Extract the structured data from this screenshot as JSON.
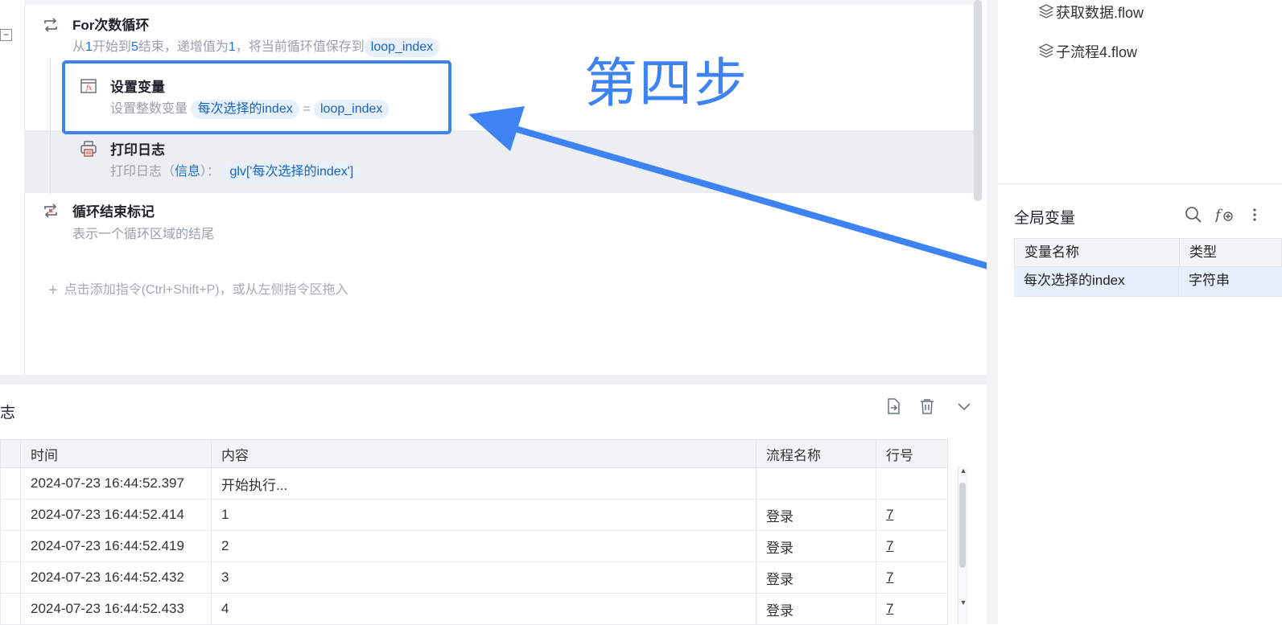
{
  "editor": {
    "collapse_symbol": "−",
    "loop_step": {
      "title": "For次数循环",
      "desc_1": "从",
      "start": "1",
      "desc_2": "开始到",
      "end": "5",
      "desc_3": "结束，递增值为",
      "step": "1",
      "desc_4": "，将当前循环值保存到",
      "var": "loop_index"
    },
    "set_var_step": {
      "title": "设置变量",
      "desc": "设置整数变量",
      "target": "每次选择的index",
      "equals": "=",
      "value": "loop_index"
    },
    "print_step": {
      "title": "打印日志",
      "desc_1": "打印日志（",
      "level": "信息",
      "desc_2": "）：",
      "expr": "glv['每次选择的index']"
    },
    "loop_end_step": {
      "title": "循环结束标记",
      "desc": "表示一个循环区域的结尾"
    },
    "add_hint": "点击添加指令(Ctrl+Shift+P)，或从左侧指令区拖入",
    "annotation": "第四步"
  },
  "log": {
    "title": "志",
    "columns": [
      "时间",
      "内容",
      "流程名称",
      "行号"
    ],
    "rows": [
      {
        "time": "2024-07-23 16:44:52.397",
        "content": "开始执行...",
        "flow": "",
        "line": ""
      },
      {
        "time": "2024-07-23 16:44:52.414",
        "content": "1",
        "flow": "登录",
        "line": "7"
      },
      {
        "time": "2024-07-23 16:44:52.419",
        "content": "2",
        "flow": "登录",
        "line": "7"
      },
      {
        "time": "2024-07-23 16:44:52.432",
        "content": "3",
        "flow": "登录",
        "line": "7"
      },
      {
        "time": "2024-07-23 16:44:52.433",
        "content": "4",
        "flow": "登录",
        "line": "7"
      }
    ]
  },
  "files": [
    {
      "name": "获取数据.flow",
      "icon": "layers-icon"
    },
    {
      "name": "子流程4.flow",
      "icon": "layers-icon"
    }
  ],
  "global_vars": {
    "title": "全局变量",
    "columns": [
      "变量名称",
      "类型"
    ],
    "rows": [
      {
        "name": "每次选择的index",
        "type": "字符串"
      }
    ]
  },
  "colors": {
    "accent": "#3d83f4",
    "chip_bg": "#e7f0fb",
    "chip_text": "#1765c1"
  }
}
